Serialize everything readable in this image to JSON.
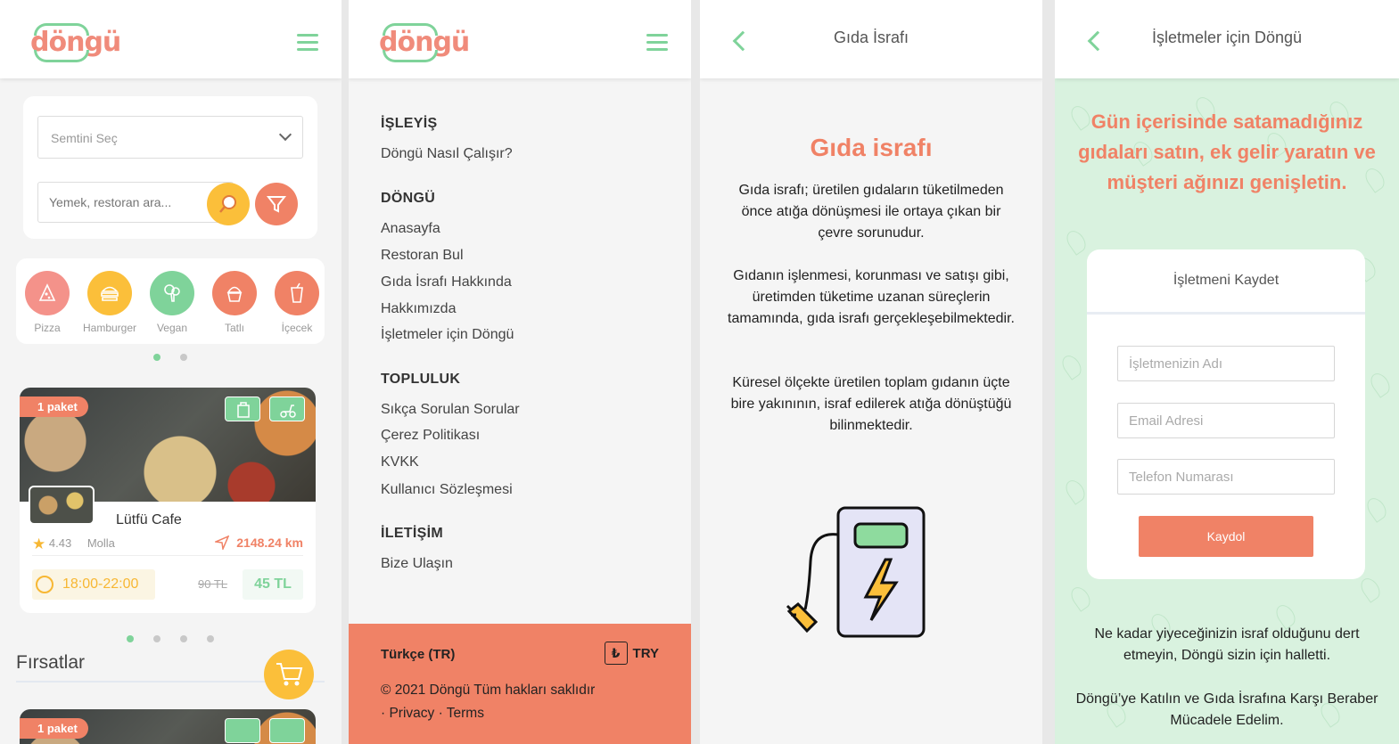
{
  "colors": {
    "accent_green": "#7fd39a",
    "accent_coral": "#f08266",
    "accent_yellow": "#fbbf3a"
  },
  "logo": "döngü",
  "screen1": {
    "select_placeholder": "Semtini Seç",
    "search_placeholder": "Yemek, restoran ara...",
    "categories": [
      {
        "label": "Pizza",
        "icon": "pizza-icon",
        "color": "#f4928a"
      },
      {
        "label": "Hamburger",
        "icon": "hamburger-icon",
        "color": "#fbbf3a"
      },
      {
        "label": "Vegan",
        "icon": "broccoli-icon",
        "color": "#7fd39a"
      },
      {
        "label": "Tatlı",
        "icon": "cupcake-icon",
        "color": "#f08266"
      },
      {
        "label": "İçecek",
        "icon": "drink-icon",
        "color": "#f08266"
      }
    ],
    "restaurant": {
      "badge": "1 paket",
      "name": "Lütfü Cafe",
      "rating": "4.43",
      "district": "Molla",
      "distance": "2148.24 km",
      "hours": "18:00-22:00",
      "old_price": "90 TL",
      "new_price": "45 TL"
    },
    "section_title": "Fırsatlar",
    "restaurant2_badge": "1 paket"
  },
  "screen2": {
    "sections": [
      {
        "title": "İŞLEYİŞ",
        "items": [
          "Döngü Nasıl Çalışır?"
        ]
      },
      {
        "title": "DÖNGÜ",
        "items": [
          "Anasayfa",
          "Restoran Bul",
          "Gıda İsrafı Hakkında",
          "Hakkımızda",
          "İşletmeler için Döngü"
        ]
      },
      {
        "title": "TOPLULUK",
        "items": [
          "Sıkça Sorulan Sorular",
          "Çerez Politikası",
          "KVKK",
          "Kullanıcı Sözleşmesi"
        ]
      },
      {
        "title": "İLETİŞİM",
        "items": [
          "Bize Ulaşın"
        ]
      }
    ],
    "footer": {
      "language": "Türkçe (TR)",
      "currency_symbol": "₺",
      "currency": "TRY",
      "copyright": "© 2021 Döngü Tüm hakları saklıdır",
      "links": "· Privacy · Terms"
    }
  },
  "screen3": {
    "top_title": "Gıda İsrafı",
    "title": "Gıda israfı",
    "paragraphs": [
      "Gıda israfı; üretilen gıdaların tüketilmeden önce atığa dönüşmesi ile ortaya çıkan bir çevre sorunudur.",
      "Gıdanın işlenmesi, korunması ve satışı gibi, üretimden tüketime uzanan süreçlerin tamamında, gıda israfı gerçekleşebilmektedir.",
      "Küresel ölçekte üretilen toplam gıdanın üçte bire yakınının, israf edilerek atığa dönüştüğü bilinmektedir."
    ]
  },
  "screen4": {
    "top_title": "İşletmeler için Döngü",
    "headline": "Gün içerisinde satamadığınız gıdaları satın, ek gelir yaratın ve müşteri ağınızı genişletin.",
    "form": {
      "title": "İşletmeni Kaydet",
      "name_placeholder": "İşletmenizin Adı",
      "email_placeholder": "Email Adresi",
      "phone_placeholder": "Telefon Numarası",
      "submit": "Kaydol"
    },
    "paragraphs": [
      "Ne kadar yiyeceğinizin israf olduğunu dert etmeyin, Döngü sizin için halletti.",
      "Döngü’ye Katılın ve Gıda İsrafına Karşı Beraber Mücadele Edelim."
    ]
  }
}
